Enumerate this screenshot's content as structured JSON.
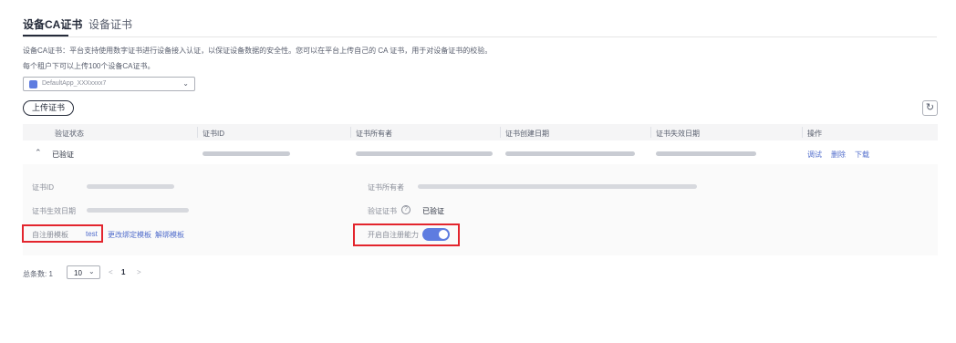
{
  "tabs": [
    {
      "label": "设备CA证书",
      "active": true
    },
    {
      "label": "设备证书",
      "active": false
    }
  ],
  "description": {
    "line1": "设备CA证书：平台支持使用数字证书进行设备接入认证，以保证设备数据的安全性。您可以在平台上传自己的 CA 证书，用于对设备证书的校验。",
    "line2": "每个租户下可以上传100个设备CA证书。"
  },
  "app_select": {
    "value": "DefaultApp_XXXxxxx7",
    "icon": "cube-icon"
  },
  "toolbar": {
    "upload_label": "上传证书",
    "refresh_icon": "refresh-icon"
  },
  "table": {
    "headers": [
      "验证状态",
      "证书ID",
      "证书所有者",
      "证书创建日期",
      "证书失效日期",
      "操作"
    ],
    "row": {
      "status": "已验证",
      "actions": [
        "调试",
        "删除",
        "下载"
      ]
    }
  },
  "detail": {
    "cert_id_label": "证书ID",
    "validity_label": "证书生效日期",
    "owner_label": "证书所有者",
    "verify_label": "验证证书",
    "verify_value": "已验证",
    "template_label": "自注册模板",
    "template_value": "test",
    "change_template_link": "更改绑定模板",
    "unbind_template_link": "解绑模板",
    "auto_register_label": "开启自注册能力",
    "auto_register_on": true
  },
  "pager": {
    "total_label": "总条数: 1",
    "page_size": "10",
    "current_page": "1"
  },
  "colors": {
    "accent": "#5e7ce0",
    "link": "#526ecc",
    "highlight_box": "#e3252d"
  }
}
